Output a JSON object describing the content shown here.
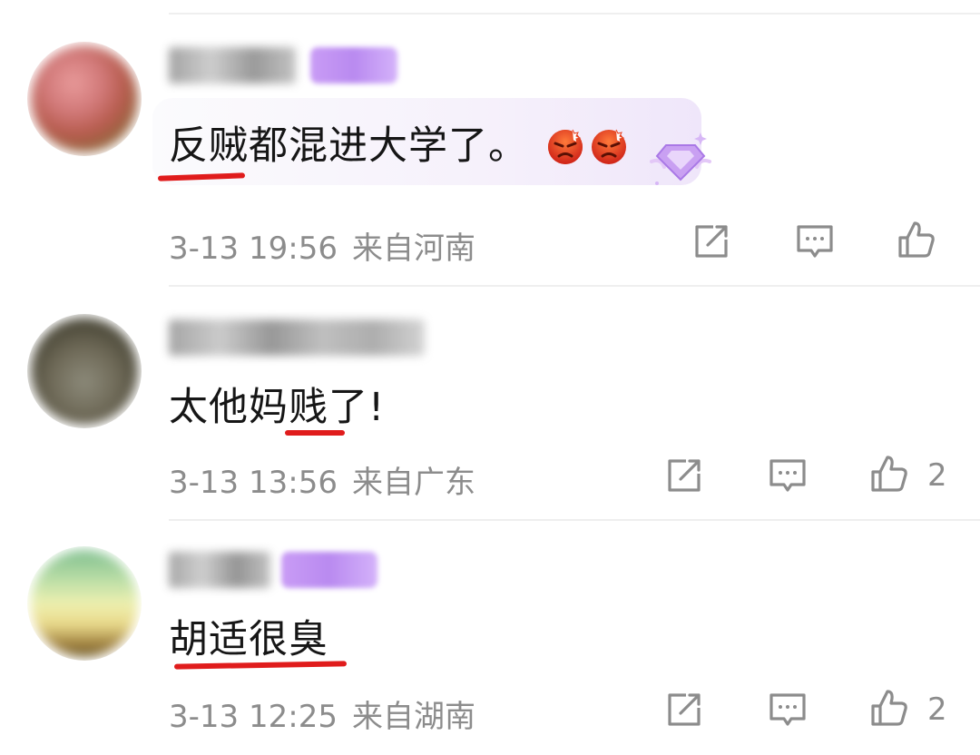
{
  "comments": [
    {
      "text": "反贼都混进大学了。",
      "emoji_names": [
        "angry-face-emoji",
        "angry-face-emoji"
      ],
      "date": "3-13 19:56",
      "location": "来自河南",
      "likes": ""
    },
    {
      "text": "太他妈贱了!",
      "date": "3-13 13:56",
      "location": "来自广东",
      "likes": "2"
    },
    {
      "text": "胡适很臭",
      "date": "3-13 12:25",
      "location": "来自湖南",
      "likes": "2"
    }
  ],
  "colors": {
    "underline": "#e01c1c",
    "meta": "#8c8c8c",
    "badge": "#c99cf5"
  },
  "icons": [
    "share-icon",
    "reply-icon",
    "like-icon",
    "diamond-badge-icon"
  ]
}
